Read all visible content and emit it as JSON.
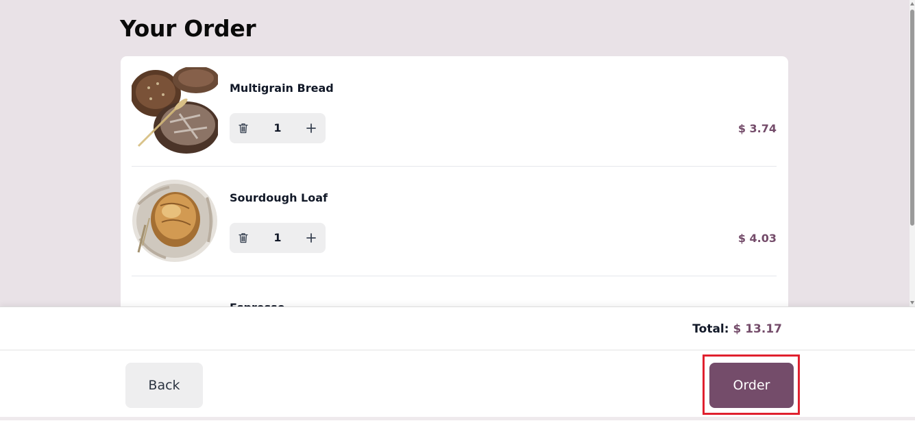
{
  "header": {
    "title": "Your Order"
  },
  "cart": {
    "items": [
      {
        "name": "Multigrain Bread",
        "quantity": "1",
        "price": "$ 3.74",
        "image_icon": "multigrain-bread-image"
      },
      {
        "name": "Sourdough Loaf",
        "quantity": "1",
        "price": "$ 4.03",
        "image_icon": "sourdough-loaf-image"
      },
      {
        "name": "Espresso",
        "image_icon": "espresso-image"
      }
    ]
  },
  "footer": {
    "total_label": "Total:",
    "total_value": "$ 13.17",
    "back_label": "Back",
    "order_label": "Order"
  },
  "colors": {
    "accent": "#744c6a",
    "page_background": "#e9e2e7",
    "highlight": "#e0202e"
  }
}
